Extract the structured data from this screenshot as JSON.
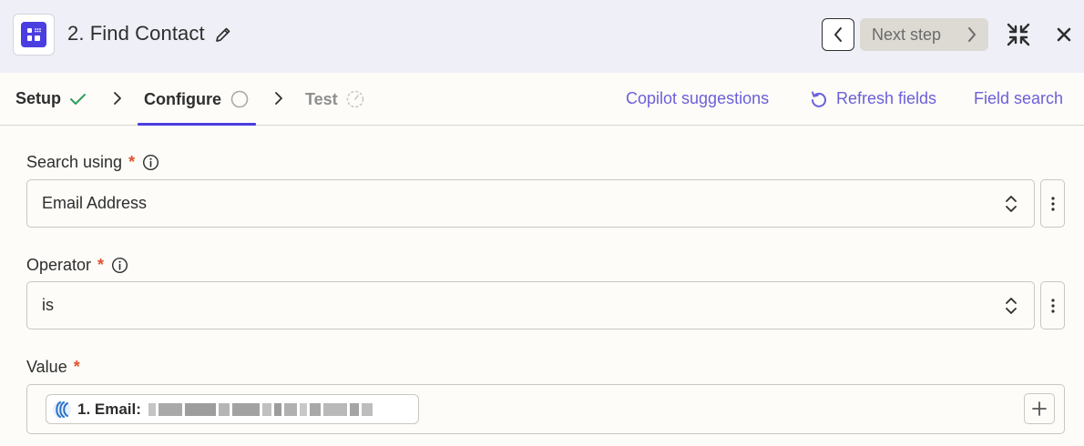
{
  "header": {
    "title": "2. Find Contact",
    "next_step_label": "Next step"
  },
  "tabs": [
    {
      "label": "Setup",
      "state": "complete"
    },
    {
      "label": "Configure",
      "state": "active"
    },
    {
      "label": "Test",
      "state": "pending"
    }
  ],
  "actions": {
    "copilot": "Copilot suggestions",
    "refresh": "Refresh fields",
    "field_search": "Field search"
  },
  "fields": {
    "search_using": {
      "label": "Search using",
      "required_mark": "*",
      "value": "Email Address"
    },
    "operator": {
      "label": "Operator",
      "required_mark": "*",
      "value": "is"
    },
    "value": {
      "label": "Value",
      "required_mark": "*",
      "pill_label": "1. Email:"
    }
  },
  "colors": {
    "accent": "#4a3ee0",
    "link": "#6b5fd9",
    "required": "#e0532b",
    "success": "#2e9e5b"
  }
}
